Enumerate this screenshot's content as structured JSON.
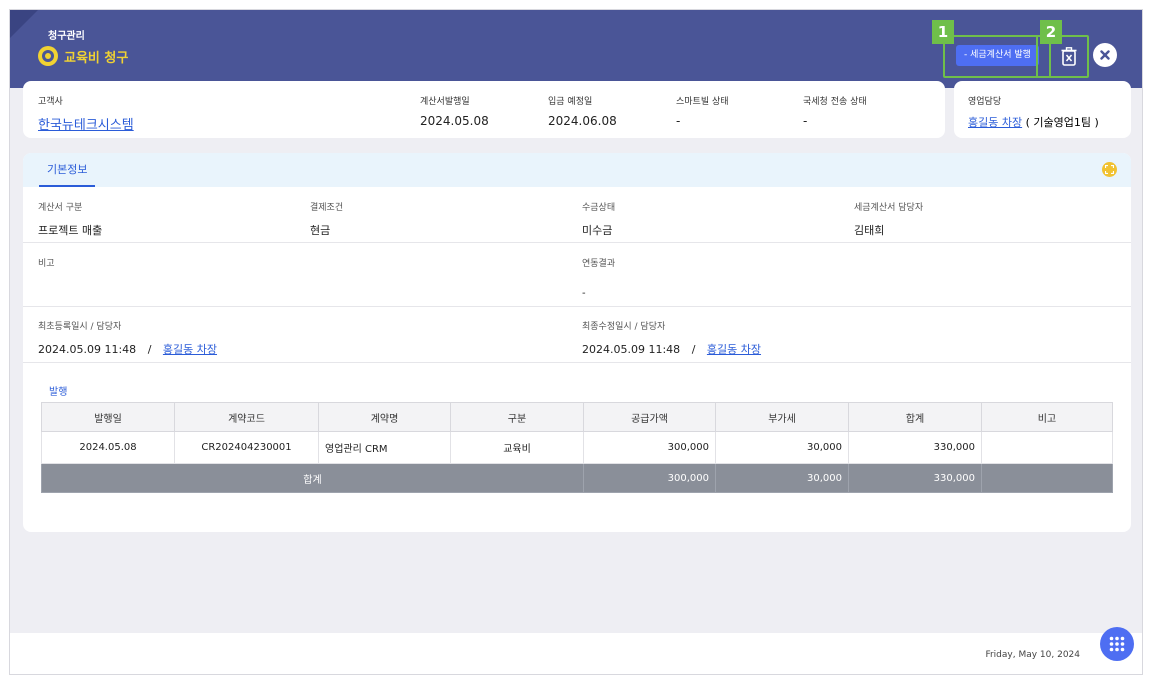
{
  "header": {
    "subtitle": "청구관리",
    "title": "교육비 청구",
    "issue_button": "- 세금계산서 발행",
    "callouts": [
      "1",
      "2"
    ]
  },
  "summary": {
    "customer_label": "고객사",
    "customer": "한국뉴테크시스템",
    "issue_date_label": "계산서발행일",
    "issue_date": "2024.05.08",
    "deposit_date_label": "입금 예정일",
    "deposit_date": "2024.06.08",
    "smartbill_label": "스마트빌 상태",
    "smartbill": "-",
    "nts_label": "국세청 전송 상태",
    "nts": "-",
    "sales_label": "영업담당",
    "sales_person": "홍길동 차장",
    "sales_team": "( 기술영업1팀 )"
  },
  "detail": {
    "tab": "기본정보",
    "invoice_type_label": "계산서 구분",
    "invoice_type": "프로젝트 매출",
    "payment_label": "결제조건",
    "payment": "현금",
    "collection_label": "수금상태",
    "collection": "미수금",
    "manager_label": "세금계산서 담당자",
    "manager": "김태희",
    "note_label": "비고",
    "link_label": "연동결과",
    "link_value": "-",
    "created_label": "최초등록일시 / 담당자",
    "created_at": "2024.05.09 11:48",
    "created_by": "홍길동 차장",
    "modified_label": "최종수정일시 / 담당자",
    "modified_at": "2024.05.09 11:48",
    "modified_by": "홍길동 차장",
    "slash": "/"
  },
  "issue_section": {
    "title": "발행",
    "columns": [
      "발행일",
      "계약코드",
      "계약명",
      "구분",
      "공급가액",
      "부가세",
      "합계",
      "비고"
    ],
    "rows": [
      [
        "2024.05.08",
        "CR202404230001",
        "영업관리 CRM",
        "교육비",
        "300,000",
        "30,000",
        "330,000",
        ""
      ]
    ],
    "total": {
      "label": "합계",
      "supply": "300,000",
      "vat": "30,000",
      "sum": "330,000",
      "note": ""
    }
  },
  "footer": {
    "date": "Friday, May 10, 2024"
  },
  "colors": {
    "header": "#4a5597",
    "accent": "#4e6ef2",
    "callout": "#6fbf4a",
    "title_yellow": "#f1d232"
  }
}
